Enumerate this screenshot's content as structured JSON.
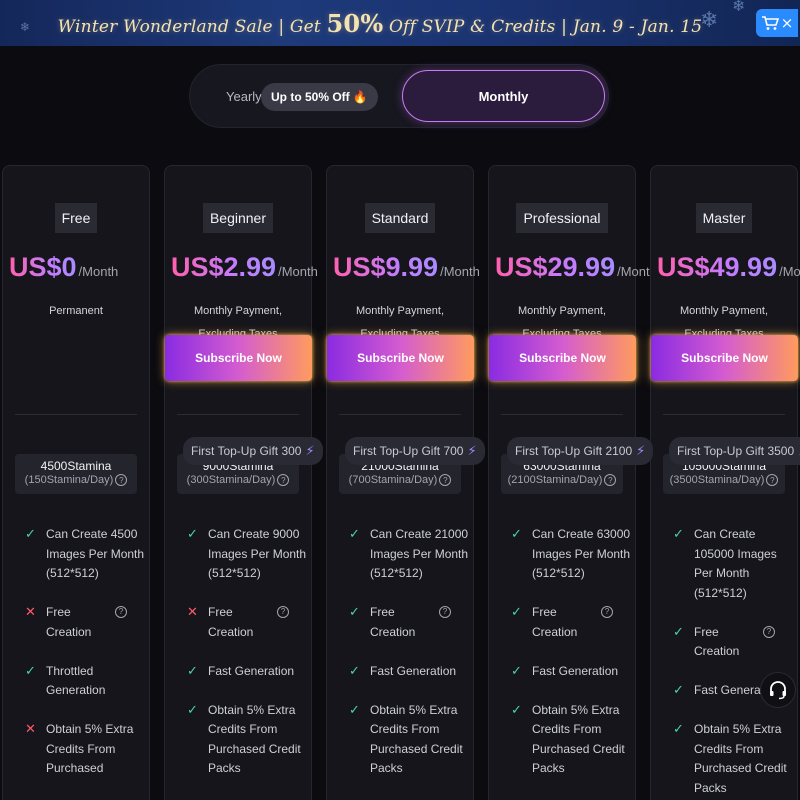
{
  "banner": {
    "prefix": "Winter Wonderland Sale | Get ",
    "highlight": "50%",
    "suffix": " Off SVIP & Credits | Jan. 9 - Jan. 15",
    "cart_icon": "cart-icon",
    "close_glyph": "×"
  },
  "toggle": {
    "yearly_label": "Yearly",
    "discount_label": "Up to 50% Off",
    "discount_icon": "🔥",
    "monthly_label": "Monthly",
    "selected": "Monthly"
  },
  "colors": {
    "accent_gradient_start": "#8a2be2",
    "accent_gradient_end": "#ff9b5e",
    "check": "#4ad2b4",
    "cross": "#ff5a6a"
  },
  "plans": [
    {
      "name": "Free",
      "price": "US$0",
      "per": "/Month",
      "billing": "Permanent",
      "has_subscribe": false,
      "subscribe_label": "",
      "gift": "",
      "stamina": "4500Stamina",
      "daily": "(150Stamina/Day)",
      "features": [
        {
          "mark": "yes",
          "text": "Can Create 4500 Images Per Month (512*512)",
          "help": false
        },
        {
          "mark": "no",
          "text": "Free Creation",
          "help": true
        },
        {
          "mark": "yes",
          "text": "Throttled Generation",
          "help": false
        },
        {
          "mark": "no",
          "text": "Obtain 5% Extra Credits From Purchased",
          "help": false
        }
      ]
    },
    {
      "name": "Beginner",
      "price": "US$2.99",
      "per": "/Month",
      "billing": "Monthly Payment, Excluding Taxes",
      "has_subscribe": true,
      "subscribe_label": "Subscribe Now",
      "gift": "First Top-Up Gift 300",
      "stamina": "9000Stamina",
      "daily": "(300Stamina/Day)",
      "features": [
        {
          "mark": "yes",
          "text": "Can Create 9000 Images Per Month (512*512)",
          "help": false
        },
        {
          "mark": "no",
          "text": "Free Creation",
          "help": true
        },
        {
          "mark": "yes",
          "text": "Fast Generation",
          "help": false
        },
        {
          "mark": "yes",
          "text": "Obtain 5% Extra Credits From Purchased Credit Packs",
          "help": false
        }
      ]
    },
    {
      "name": "Standard",
      "price": "US$9.99",
      "per": "/Month",
      "billing": "Monthly Payment, Excluding Taxes",
      "has_subscribe": true,
      "subscribe_label": "Subscribe Now",
      "gift": "First Top-Up Gift 700",
      "stamina": "21000Stamina",
      "daily": "(700Stamina/Day)",
      "features": [
        {
          "mark": "yes",
          "text": "Can Create 21000 Images Per Month (512*512)",
          "help": false
        },
        {
          "mark": "yes",
          "text": "Free Creation",
          "help": true
        },
        {
          "mark": "yes",
          "text": "Fast Generation",
          "help": false
        },
        {
          "mark": "yes",
          "text": "Obtain 5% Extra Credits From Purchased Credit Packs",
          "help": false
        }
      ]
    },
    {
      "name": "Professional",
      "price": "US$29.99",
      "per": "/Month",
      "billing": "Monthly Payment, Excluding Taxes",
      "has_subscribe": true,
      "subscribe_label": "Subscribe Now",
      "gift": "First Top-Up Gift 2100",
      "stamina": "63000Stamina",
      "daily": "(2100Stamina/Day)",
      "features": [
        {
          "mark": "yes",
          "text": "Can Create 63000 Images Per Month (512*512)",
          "help": false
        },
        {
          "mark": "yes",
          "text": "Free Creation",
          "help": true
        },
        {
          "mark": "yes",
          "text": "Fast Generation",
          "help": false
        },
        {
          "mark": "yes",
          "text": "Obtain 5% Extra Credits From Purchased Credit Packs",
          "help": false
        }
      ]
    },
    {
      "name": "Master",
      "price": "US$49.99",
      "per": "/Month",
      "billing": "Monthly Payment, Excluding Taxes",
      "has_subscribe": true,
      "subscribe_label": "Subscribe Now",
      "gift": "First Top-Up Gift 3500",
      "stamina": "105000Stamina",
      "daily": "(3500Stamina/Day)",
      "features": [
        {
          "mark": "yes",
          "text": "Can Create 105000 Images Per Month (512*512)",
          "help": false
        },
        {
          "mark": "yes",
          "text": "Free Creation",
          "help": true
        },
        {
          "mark": "yes",
          "text": "Fast Generation",
          "help": false
        },
        {
          "mark": "yes",
          "text": "Obtain 5% Extra Credits From Purchased Credit Packs",
          "help": false
        }
      ]
    }
  ],
  "support": {
    "icon": "headset-icon"
  }
}
